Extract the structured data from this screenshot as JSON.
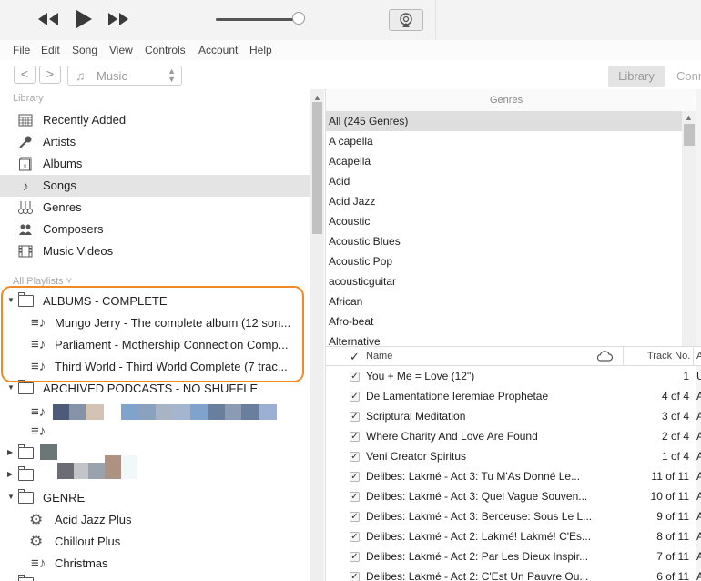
{
  "menu": [
    "File",
    "Edit",
    "Song",
    "View",
    "Controls",
    "Account",
    "Help"
  ],
  "nav": {
    "back": "<",
    "forward": ">",
    "media_kind": "Music",
    "tab_library": "Library",
    "tab_connect": "Conn"
  },
  "volume_level": 0.98,
  "sidebar": {
    "library_header": "Library",
    "library_items": [
      {
        "label": "Recently Added",
        "icon": "grid-calendar-icon"
      },
      {
        "label": "Artists",
        "icon": "microphone-icon"
      },
      {
        "label": "Albums",
        "icon": "album-icon"
      },
      {
        "label": "Songs",
        "icon": "music-note-icon",
        "selected": true
      },
      {
        "label": "Genres",
        "icon": "guitars-icon"
      },
      {
        "label": "Composers",
        "icon": "people-icon"
      },
      {
        "label": "Music Videos",
        "icon": "film-icon"
      }
    ],
    "playlists_header": "All Playlists ˅",
    "folder1": "ALBUMS - COMPLETE",
    "folder1_children": [
      "Mungo Jerry - The complete album (12 son...",
      "Parliament - Mothership Connection Comp...",
      "Third World - Third World Complete (7 trac..."
    ],
    "folder2": "ARCHIVED PODCASTS - NO SHUFFLE",
    "folder3": "GENRE",
    "folder3_children": [
      {
        "label": "Acid Jazz Plus",
        "icon": "gear-icon"
      },
      {
        "label": "Chillout Plus",
        "icon": "gear-icon"
      },
      {
        "label": "Christmas",
        "icon": "playlist-icon"
      }
    ],
    "blur_colors": [
      "#4d5a7a",
      "#8592a8",
      "#d4c2b5",
      "#7fa3cc",
      "#8aa2be",
      "#a8b4c4",
      "#a5b5cf",
      "#6a7f9e",
      "#8a9bb3",
      "#9cb0d4",
      "#6b7777",
      "#9aa3ad",
      "#6c6c74",
      "#c2c4c8",
      "#ad9181",
      "#f1f8fa"
    ]
  },
  "genres": {
    "header": "Genres",
    "items": [
      "All (245 Genres)",
      "A capella",
      "Acapella",
      "Acid",
      "Acid Jazz",
      "Acoustic",
      "Acoustic Blues",
      "Acoustic Pop",
      "acousticguitar",
      "African",
      "Afro-beat",
      "Alternative"
    ]
  },
  "tracks": {
    "header_check": "✓",
    "header_name": "Name",
    "header_track": "Track No.",
    "header_extra": "A",
    "rows": [
      {
        "name": "You + Me = Love (12\")",
        "track": "1",
        "extra": "U"
      },
      {
        "name": "De Lamentatione Ieremiae Prophetae",
        "track": "4 of 4",
        "extra": "A"
      },
      {
        "name": "Scriptural Meditation",
        "track": "3 of 4",
        "extra": "A"
      },
      {
        "name": "Where Charity And Love Are Found",
        "track": "2 of 4",
        "extra": "A"
      },
      {
        "name": "Veni Creator Spiritus",
        "track": "1 of 4",
        "extra": "A"
      },
      {
        "name": "Delibes: Lakmé - Act 3: Tu M'As Donné Le...",
        "track": "11 of 11",
        "extra": "A"
      },
      {
        "name": "Delibes: Lakmé - Act 3: Quel Vague Souven...",
        "track": "10 of 11",
        "extra": "A"
      },
      {
        "name": "Delibes: Lakmé - Act 3: Berceuse: Sous Le L...",
        "track": "9 of 11",
        "extra": "A"
      },
      {
        "name": "Delibes: Lakmé - Act 2: Lakmé! Lakmé! C'Es...",
        "track": "8 of 11",
        "extra": "A"
      },
      {
        "name": "Delibes: Lakmé - Act 2: Par Les Dieux Inspir...",
        "track": "7 of 11",
        "extra": "A"
      },
      {
        "name": "Delibes: Lakmé - Act 2: C'Est Un Pauvre Ou...",
        "track": "6 of 11",
        "extra": "A"
      }
    ]
  }
}
